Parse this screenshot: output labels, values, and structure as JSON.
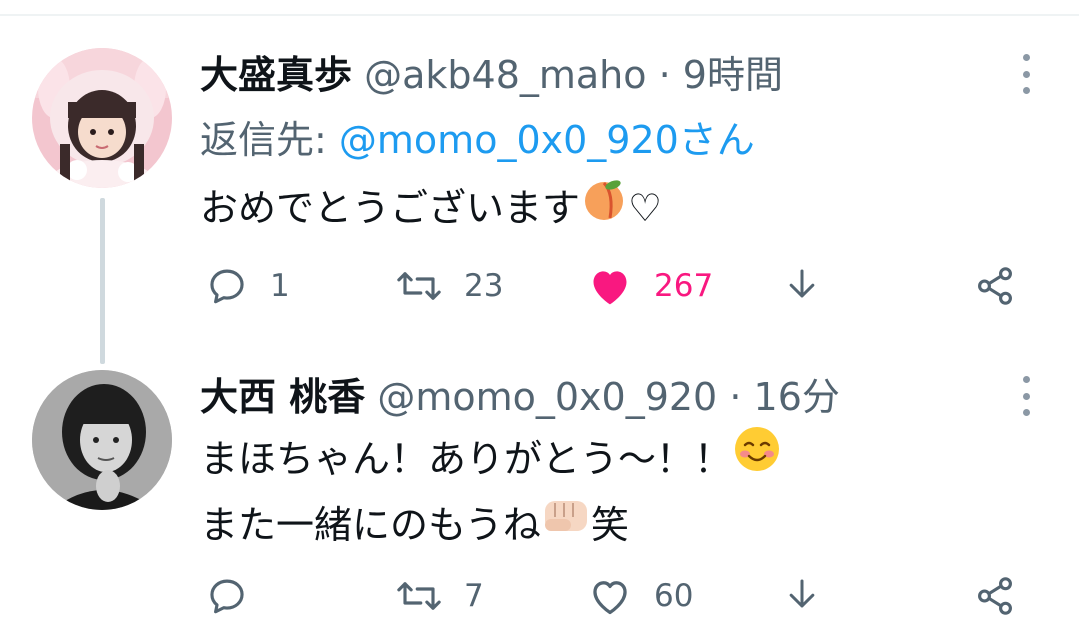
{
  "tweets": [
    {
      "name": "大盛真歩",
      "handle": "@akb48_maho",
      "separator": "·",
      "time": "9時間",
      "reply_prefix": "返信先:",
      "reply_mention": "@momo_0x0_920さん",
      "text_line1": "おめでとうございます",
      "text_line1_suffix": "♡",
      "inline_emoji_1": "peach-emoji",
      "replies": "1",
      "retweets": "23",
      "likes": "267",
      "liked": true,
      "accent_like": "#f91880"
    },
    {
      "name": "大西 桃香",
      "handle": "@momo_0x0_920",
      "separator": "·",
      "time": "16分",
      "text_line1": "まほちゃん！ありがとう〜！！",
      "text_line2": "また一緒にのもうね",
      "text_line2_suffix": "笑",
      "inline_emoji_1": "smiling-blush-emoji",
      "inline_emoji_2": "fist-emoji",
      "replies": "",
      "retweets": "7",
      "likes": "60",
      "liked": false
    }
  ]
}
